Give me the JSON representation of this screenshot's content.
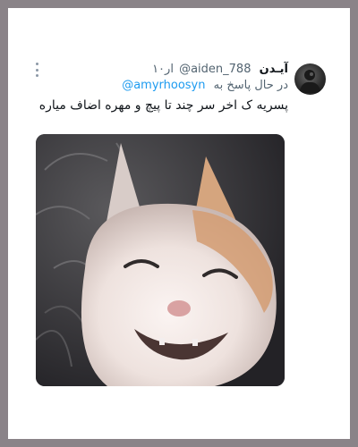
{
  "tweet": {
    "display_name": "آیـدن",
    "handle": "@aiden_788",
    "time": "۱۰ار",
    "reply_prefix": "در حال پاسخ به",
    "reply_to": "@amyrhoosyn",
    "text": "پسریه ک اخر سر چند تا پیچ و مهره اضاف میاره"
  },
  "media": {
    "icon": "smiling-cat-photo"
  },
  "colors": {
    "frame": "#8a8388",
    "card": "#ffffff",
    "mention": "#1d9bf0",
    "secondary_text": "#536471",
    "primary_text": "#0f1419"
  }
}
